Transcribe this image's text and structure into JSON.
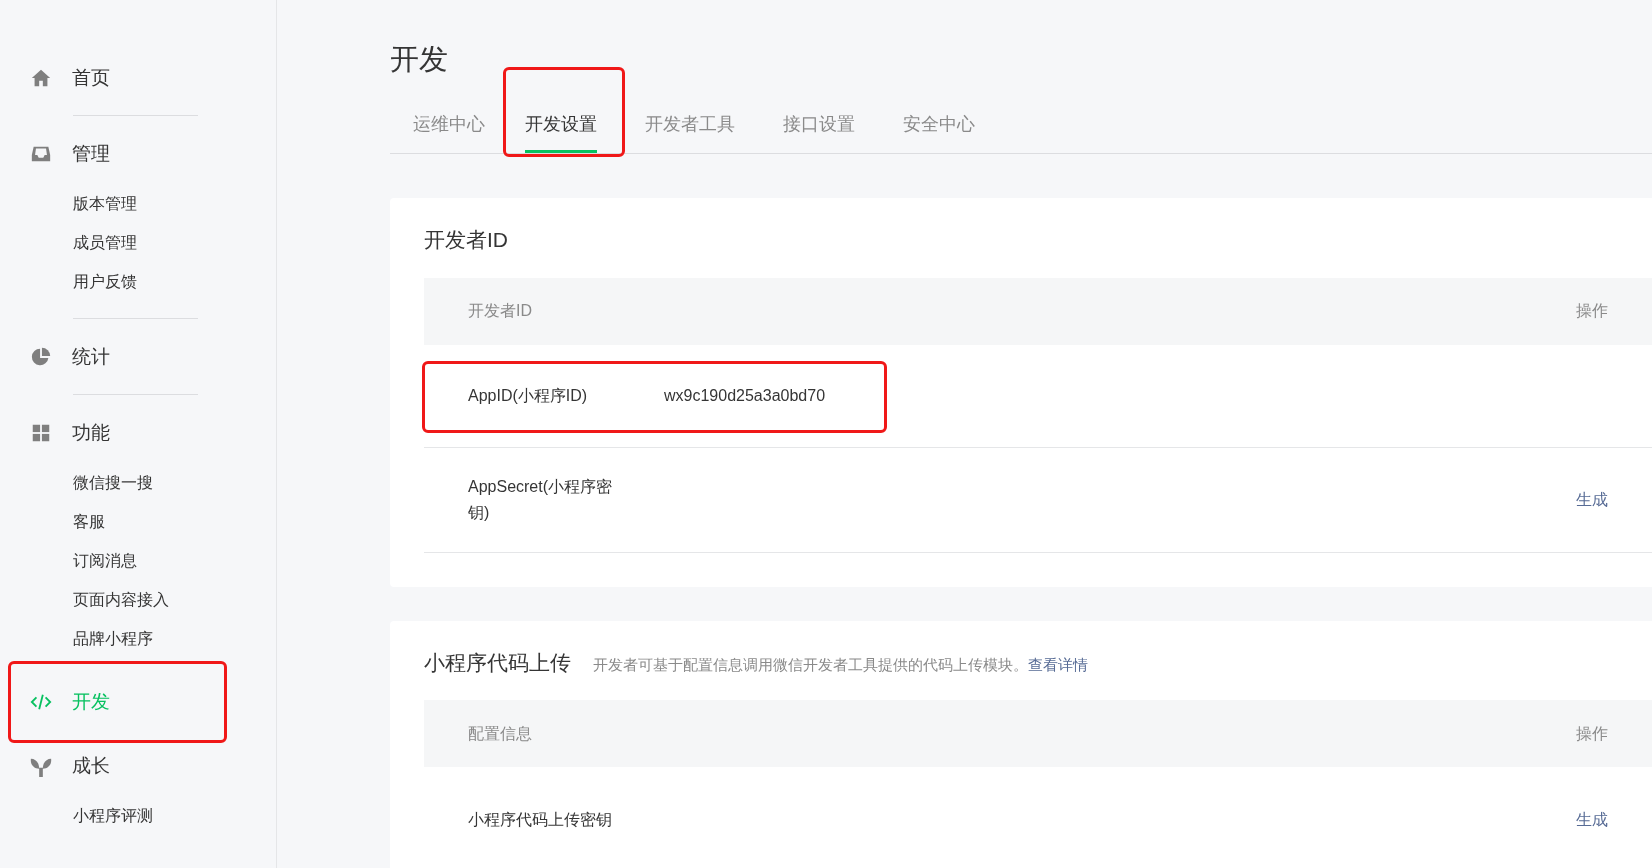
{
  "sidebar": {
    "groups": [
      {
        "label": "首页",
        "selected": false,
        "highlighted": false
      },
      {
        "label": "管理",
        "selected": false,
        "highlighted": false,
        "children": [
          {
            "label": "版本管理"
          },
          {
            "label": "成员管理"
          },
          {
            "label": "用户反馈"
          }
        ]
      },
      {
        "label": "统计",
        "selected": false,
        "highlighted": false
      },
      {
        "label": "功能",
        "selected": false,
        "highlighted": false,
        "children": [
          {
            "label": "微信搜一搜"
          },
          {
            "label": "客服"
          },
          {
            "label": "订阅消息"
          },
          {
            "label": "页面内容接入"
          },
          {
            "label": "品牌小程序"
          }
        ]
      },
      {
        "label": "开发",
        "selected": true,
        "highlighted": true
      },
      {
        "label": "成长",
        "selected": false,
        "highlighted": false,
        "children": [
          {
            "label": "小程序评测"
          }
        ]
      }
    ]
  },
  "page_title": "开发",
  "tabs": [
    {
      "label": "运维中心",
      "selected": false,
      "highlighted": false
    },
    {
      "label": "开发设置",
      "selected": true,
      "highlighted": true
    },
    {
      "label": "开发者工具",
      "selected": false,
      "highlighted": false
    },
    {
      "label": "接口设置",
      "selected": false,
      "highlighted": false
    },
    {
      "label": "安全中心",
      "selected": false,
      "highlighted": false
    }
  ],
  "cards": [
    {
      "title": "开发者ID",
      "columns": [
        "开发者ID",
        "操作"
      ],
      "rows": [
        {
          "label": "AppID(小程序ID)",
          "value": "wx9c190d25a3a0bd70",
          "highlighted": true
        },
        {
          "label": "AppSecret(小程序密钥)",
          "action": "生成",
          "highlighted": false
        }
      ]
    },
    {
      "title": "小程序代码上传",
      "description": "开发者可基于配置信息调用微信开发者工具提供的代码上传模块。",
      "link": "查看详情",
      "columns": [
        "配置信息",
        "操作"
      ],
      "rows": [
        {
          "label": "小程序代码上传密钥",
          "action": "生成",
          "highlighted": false
        }
      ]
    }
  ]
}
